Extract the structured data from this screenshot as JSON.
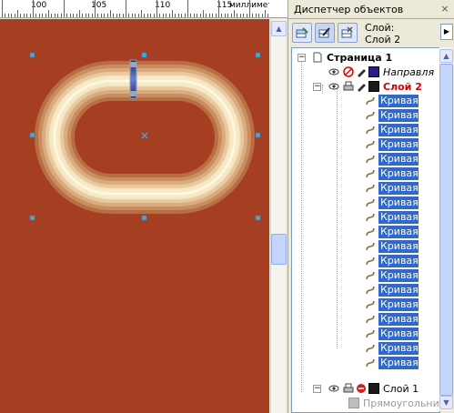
{
  "ruler": {
    "labels": [
      "100",
      "105",
      "110",
      "115",
      "миллиметры"
    ]
  },
  "docker": {
    "title": "Диспетчер объектов",
    "close_glyph": "×",
    "current_layer_line1": "Слой:",
    "current_layer_line2": "Слой 2",
    "menu_arrow": "▶"
  },
  "tree": {
    "page": "Страница 1",
    "guides_layer": "Направля",
    "layer2": "Слой 2",
    "curve_label": "Кривая",
    "curve_count": 19,
    "layer1": "Слой 1",
    "rectangle": "Прямоугольник"
  },
  "icons": {
    "eye": "eye-icon",
    "print": "printer-icon",
    "edit": "pencil-icon",
    "curve": "curve-icon",
    "page": "page-icon"
  },
  "colors": {
    "canvas_bg": "#a63f22",
    "selection": "#316ac5",
    "layer2_text": "#d40000",
    "guides_swatch": "#2b1b8f",
    "layer_swatch": "#1a1a1a"
  }
}
